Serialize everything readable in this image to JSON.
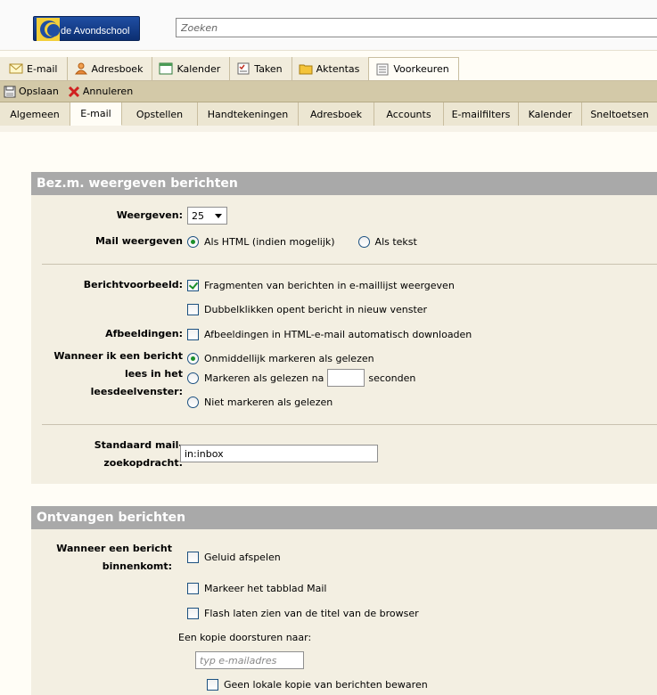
{
  "header": {
    "logo_text": "de Avondschool",
    "search_placeholder": "Zoeken"
  },
  "app_tabs": [
    {
      "label": "E-mail",
      "icon": "envelope-icon"
    },
    {
      "label": "Adresboek",
      "icon": "contacts-icon"
    },
    {
      "label": "Kalender",
      "icon": "calendar-icon"
    },
    {
      "label": "Taken",
      "icon": "tasks-icon"
    },
    {
      "label": "Aktentas",
      "icon": "briefcase-icon"
    },
    {
      "label": "Voorkeuren",
      "icon": "preferences-icon"
    }
  ],
  "toolbar": {
    "save_label": "Opslaan",
    "cancel_label": "Annuleren"
  },
  "sub_tabs": [
    {
      "label": "Algemeen"
    },
    {
      "label": "E-mail"
    },
    {
      "label": "Opstellen"
    },
    {
      "label": "Handtekeningen"
    },
    {
      "label": "Adresboek"
    },
    {
      "label": "Accounts"
    },
    {
      "label": "E-mailfilters"
    },
    {
      "label": "Kalender"
    },
    {
      "label": "Sneltoetsen"
    }
  ],
  "section_display": {
    "title": "Bez.m. weergeven berichten",
    "show_label": "Weergeven:",
    "show_value": "25",
    "mail_display_label": "Mail weergeven",
    "opt_html": "Als HTML (indien mogelijk)",
    "opt_text": "Als tekst",
    "preview_label": "Berichtvoorbeeld:",
    "preview_snippets": "Fragmenten van berichten in e-maillijst weergeven",
    "preview_dblclick": "Dubbelklikken opent bericht in nieuw venster",
    "images_label": "Afbeeldingen:",
    "images_option": "Afbeeldingen in HTML-e-mail automatisch downloaden",
    "read_label_1": "Wanneer ik een bericht",
    "read_label_2": "lees in het",
    "read_label_3": "leesdeelvenster:",
    "read_opt_immediate": "Onmiddellijk markeren als gelezen",
    "read_opt_after": "Markeren als gelezen na",
    "read_opt_after_suffix": "seconden",
    "read_opt_never": "Niet markeren als gelezen",
    "default_search_label_1": "Standaard mail-",
    "default_search_label_2": "zoekopdracht:",
    "default_search_value": "in:inbox"
  },
  "section_receive": {
    "title": "Ontvangen berichten",
    "arrival_label_1": "Wanneer een bericht",
    "arrival_label_2": "binnenkomt:",
    "opt_sound": "Geluid afspelen",
    "opt_mark_tab": "Markeer het tabblad Mail",
    "opt_flash_title": "Flash laten zien van de titel van de browser",
    "forward_label": "Een kopie doorsturen naar:",
    "forward_placeholder": "typ e-mailadres",
    "no_local_copy": "Geen lokale kopie van berichten bewaren"
  }
}
